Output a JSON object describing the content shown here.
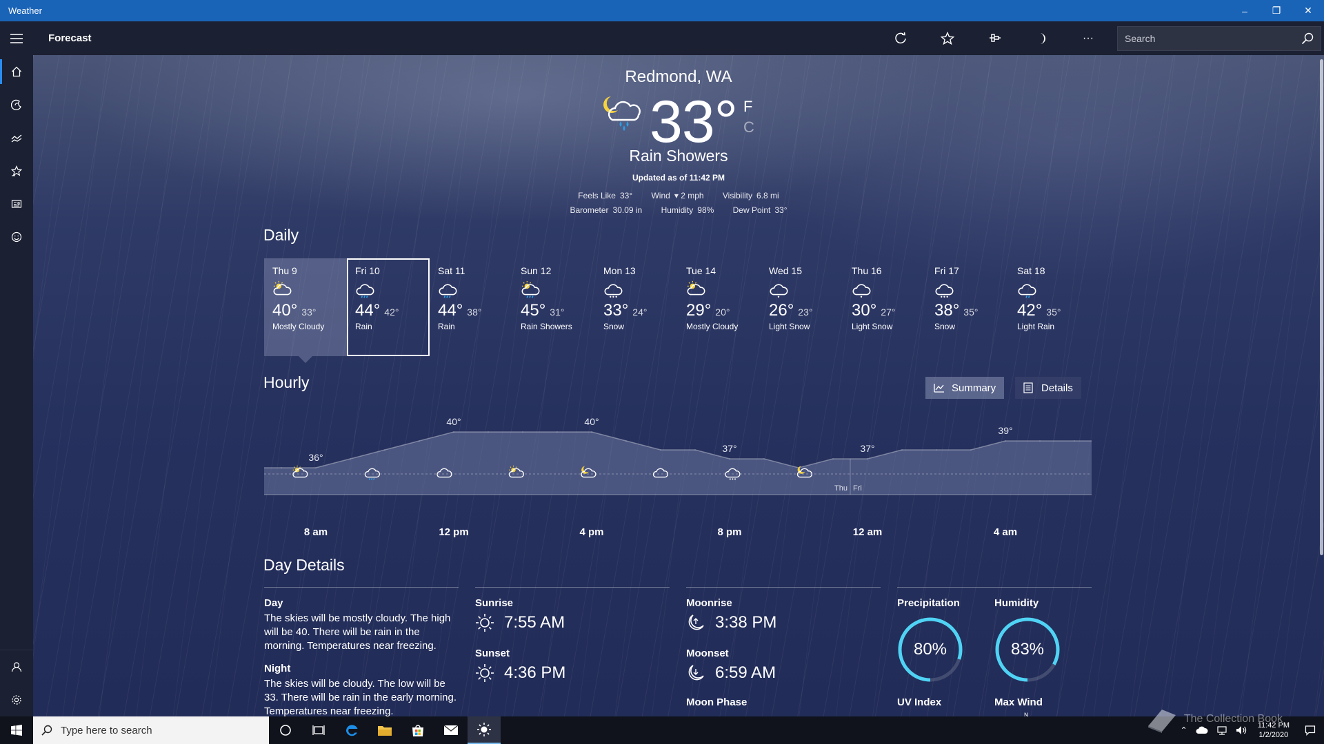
{
  "window": {
    "title": "Weather",
    "controls": [
      "–",
      "❐",
      "✕"
    ]
  },
  "appbar": {
    "title": "Forecast",
    "actions": [
      "refresh-icon",
      "favorite-icon",
      "pin-icon",
      "dark-mode-icon",
      "more-icon"
    ],
    "more_label": "···",
    "search_placeholder": "Search"
  },
  "rail": {
    "items": [
      "home-icon",
      "maps-icon",
      "historical-icon",
      "favorites-icon",
      "news-icon",
      "feedback-icon"
    ],
    "bottom": [
      "account-icon",
      "settings-icon"
    ]
  },
  "current": {
    "location": "Redmond, WA",
    "temp": "33°",
    "unit_f": "F",
    "unit_c": "C",
    "condition": "Rain Showers",
    "updated": "Updated as of 11:42 PM",
    "feels_like_label": "Feels Like",
    "feels_like": "33°",
    "wind_label": "Wind",
    "wind": "2 mph",
    "visibility_label": "Visibility",
    "visibility": "6.8 mi",
    "barometer_label": "Barometer",
    "barometer": "30.09 in",
    "humidity_label": "Humidity",
    "humidity": "98%",
    "dew_point_label": "Dew Point",
    "dew_point": "33°"
  },
  "daily": {
    "title": "Daily",
    "days": [
      {
        "day": "Thu 9",
        "hi": "40°",
        "lo": "33°",
        "cond": "Mostly Cloudy",
        "icon": "partly-cloudy-icon"
      },
      {
        "day": "Fri 10",
        "hi": "44°",
        "lo": "42°",
        "cond": "Rain",
        "icon": "rain-icon"
      },
      {
        "day": "Sat 11",
        "hi": "44°",
        "lo": "38°",
        "cond": "Rain",
        "icon": "rain-icon"
      },
      {
        "day": "Sun 12",
        "hi": "45°",
        "lo": "31°",
        "cond": "Rain Showers",
        "icon": "sun-rain-icon"
      },
      {
        "day": "Mon 13",
        "hi": "33°",
        "lo": "24°",
        "cond": "Snow",
        "icon": "snow-icon"
      },
      {
        "day": "Tue 14",
        "hi": "29°",
        "lo": "20°",
        "cond": "Mostly Cloudy",
        "icon": "partly-cloudy-icon"
      },
      {
        "day": "Wed 15",
        "hi": "26°",
        "lo": "23°",
        "cond": "Light Snow",
        "icon": "light-snow-icon"
      },
      {
        "day": "Thu 16",
        "hi": "30°",
        "lo": "27°",
        "cond": "Light Snow",
        "icon": "light-snow-icon"
      },
      {
        "day": "Fri 17",
        "hi": "38°",
        "lo": "35°",
        "cond": "Snow",
        "icon": "snow-icon"
      },
      {
        "day": "Sat 18",
        "hi": "42°",
        "lo": "35°",
        "cond": "Light Rain",
        "icon": "light-rain-icon"
      }
    ]
  },
  "hourly": {
    "title": "Hourly",
    "summary_label": "Summary",
    "details_label": "Details",
    "day_split": [
      "Thu",
      "Fri"
    ],
    "time_labels": [
      "8 am",
      "12 pm",
      "4 pm",
      "8 pm",
      "12 am",
      "4 am"
    ]
  },
  "chart_data": {
    "type": "area",
    "x": [
      "7 am",
      "8 am",
      "9 am",
      "10 am",
      "11 am",
      "12 pm",
      "1 pm",
      "2 pm",
      "3 pm",
      "4 pm",
      "5 pm",
      "6 pm",
      "7 pm",
      "8 pm",
      "9 pm",
      "10 pm",
      "11 pm",
      "12 am",
      "1 am",
      "2 am",
      "3 am",
      "4 am",
      "5 am",
      "6 am"
    ],
    "series": [
      {
        "values": [
          36,
          36,
          37,
          38,
          39,
          40,
          40,
          40,
          40,
          40,
          39,
          38,
          38,
          37,
          37,
          36,
          37,
          37,
          38,
          38,
          38,
          39,
          39,
          39
        ]
      }
    ],
    "value_labels": [
      {
        "x": "8 am",
        "text": "36°"
      },
      {
        "x": "12 pm",
        "text": "40°"
      },
      {
        "x": "4 pm",
        "text": "40°"
      },
      {
        "x": "8 pm",
        "text": "37°"
      },
      {
        "x": "12 am",
        "text": "37°"
      },
      {
        "x": "4 am",
        "text": "39°"
      }
    ],
    "condition_icons": [
      "sun-cloud-icon",
      "rain-icon",
      "cloud-icon",
      "sun-cloud-icon",
      "moon-cloud-icon",
      "cloud-icon",
      "snow-icon",
      "moon-cloud-icon"
    ],
    "ylim": [
      30,
      44
    ]
  },
  "day_details": {
    "title": "Day Details",
    "day_label": "Day",
    "day_text": "The skies will be mostly cloudy. The high will be 40. There will be rain in the morning. Temperatures near freezing.",
    "night_label": "Night",
    "night_text": "The skies will be cloudy. The low will be 33. There will be rain in the early morning. Temperatures near freezing.",
    "sunrise_label": "Sunrise",
    "sunrise": "7:55 AM",
    "sunset_label": "Sunset",
    "sunset": "4:36 PM",
    "moonrise_label": "Moonrise",
    "moonrise": "3:38 PM",
    "moonset_label": "Moonset",
    "moonset": "6:59 AM",
    "moon_phase_label": "Moon Phase",
    "precipitation_label": "Precipitation",
    "precipitation": "80%",
    "precipitation_value": 0.8,
    "humidity_label": "Humidity",
    "humidity": "83%",
    "humidity_value": 0.83,
    "uv_label": "UV Index",
    "max_wind_label": "Max Wind",
    "compass_n": "N",
    "ring_color": "#4fd3f5"
  },
  "taskbar": {
    "search_placeholder": "Type here to search",
    "apps": [
      "task-view-icon",
      "cortana-icon",
      "edge-icon",
      "file-explorer-icon",
      "store-icon",
      "mail-icon",
      "weather-icon"
    ],
    "time": "11:42 PM",
    "date": "1/2/2020",
    "watermark": "The Collection Book"
  }
}
